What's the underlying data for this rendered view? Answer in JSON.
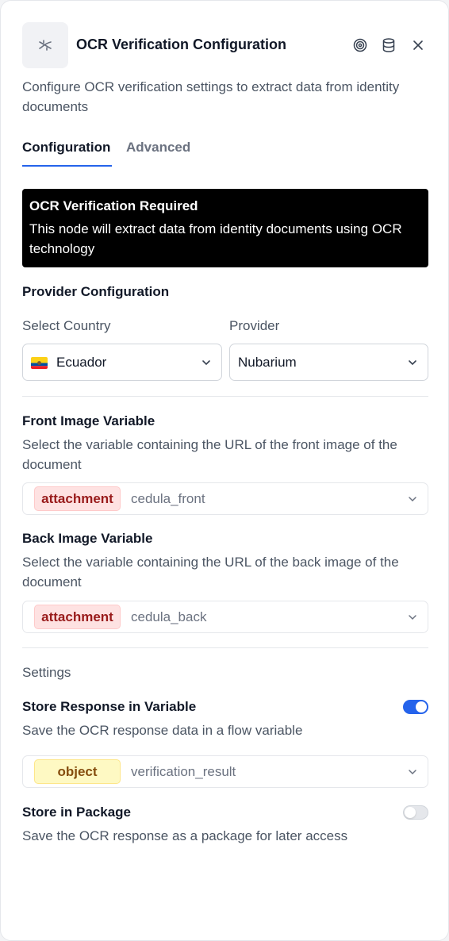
{
  "header": {
    "title": "OCR Verification Configuration",
    "description": "Configure OCR verification settings to extract data from identity documents",
    "icons": [
      "ocr-node-icon",
      "target-icon",
      "database-icon",
      "close-icon"
    ]
  },
  "tabs": [
    {
      "label": "Configuration",
      "active": true
    },
    {
      "label": "Advanced",
      "active": false
    }
  ],
  "alert": {
    "title": "OCR Verification Required",
    "text": "This node will extract data from identity documents using OCR technology"
  },
  "provider_config": {
    "section_title": "Provider Configuration",
    "country_label": "Select Country",
    "country_value": "Ecuador",
    "country_flag": "ecuador-flag-icon",
    "provider_label": "Provider",
    "provider_value": "Nubarium"
  },
  "front_image": {
    "title": "Front Image Variable",
    "help": "Select the variable containing the URL of the front image of the document",
    "type": "attachment",
    "variable": "cedula_front"
  },
  "back_image": {
    "title": "Back Image Variable",
    "help": "Select the variable containing the URL of the back image of the document",
    "type": "attachment",
    "variable": "cedula_back"
  },
  "settings": {
    "section_title": "Settings",
    "store_response": {
      "title": "Store Response in Variable",
      "help": "Save the OCR response data in a flow variable",
      "enabled": true,
      "type": "object",
      "variable": "verification_result"
    },
    "store_package": {
      "title": "Store in Package",
      "help": "Save the OCR response as a package for later access",
      "enabled": false
    }
  },
  "colors": {
    "accent": "#2563eb",
    "alert_bg": "#000000",
    "attachment_chip_bg": "#fee2e2",
    "attachment_chip_text": "#991b1b",
    "object_chip_bg": "#fef9c3",
    "object_chip_text": "#854d0e"
  }
}
